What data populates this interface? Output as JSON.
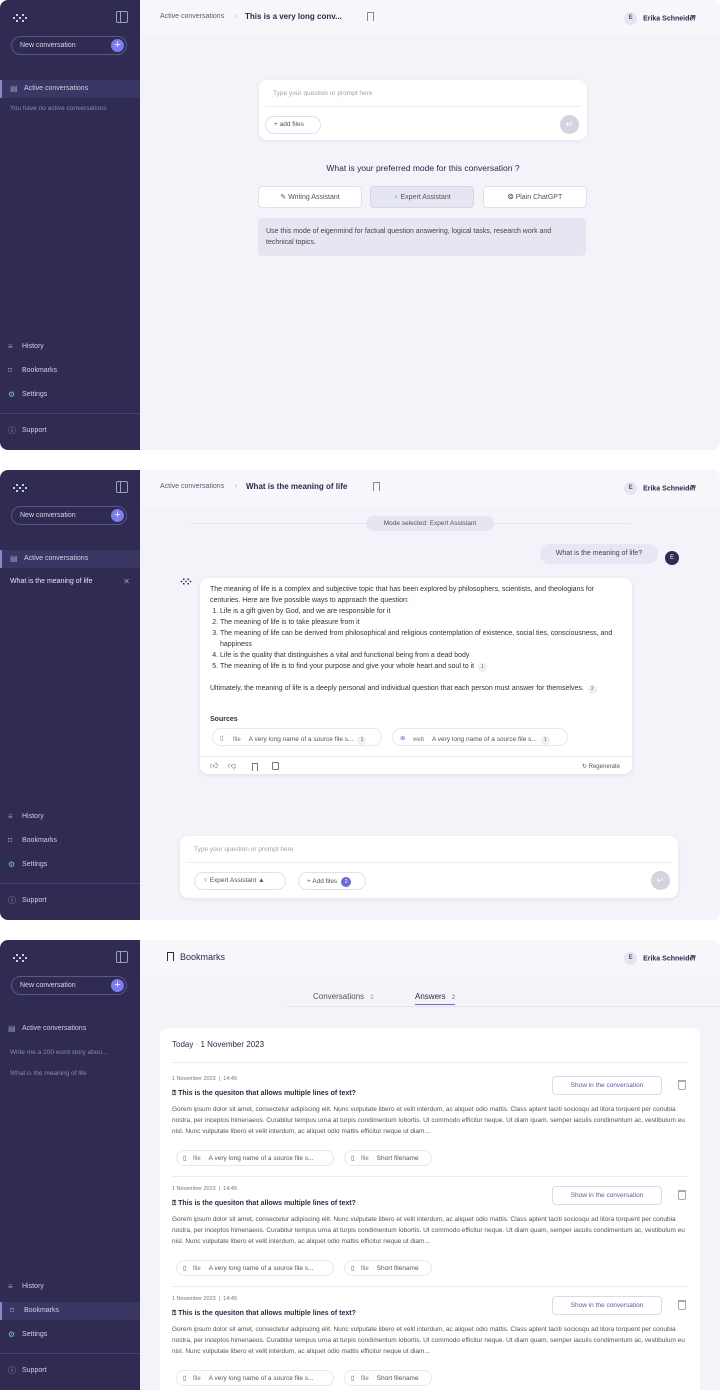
{
  "sidebar": {
    "new_conversation": "New conversation",
    "active_conversations": "Active conversations",
    "no_active": "You have no active conversations",
    "history": "History",
    "bookmarks": "Bookmarks",
    "settings": "Settings",
    "support": "Support",
    "conv_meaning": "What is the meaning of life",
    "conv_story": "Write me a 200 word story abou...",
    "conv_meaning2": "What is the meaning of life"
  },
  "header": {
    "crumb": "Active conversations",
    "title1": "This is a very long conv...",
    "title2": "What is the meaning of life",
    "user": "Erika Schneider",
    "avatar": "E",
    "bookmarks_title": "Bookmarks"
  },
  "composer": {
    "placeholder": "Type your question or prompt here",
    "add_files": "add files",
    "add_files2": "Add files",
    "file_count": "2",
    "mode": "Expert Assistant"
  },
  "mode_select": {
    "question": "What is your preferred mode for this conversation ?",
    "writing": "Writing Assistant",
    "expert": "Expert Assistant",
    "plain": "Plain ChatGPT",
    "description": "Use this mode of eigenmind for factual question answering, logical tasks, research work and technical topics."
  },
  "chat": {
    "mode_banner": "Mode selected: Expert Assistant",
    "user_msg": "What is the meaning of life?",
    "intro": "The meaning of life is a complex and subjective topic that has been explored by philosophers, scientists, and theologians for centuries. Here are five possible ways to approach the question:",
    "points": [
      "Life is a gift given by God, and we are responsible for it",
      "The meaning of life is to take pleasure from it",
      "The meaning of life can be derived from philosophical and religious contemplation of existence, social ties, consciousness, and happiness",
      "Life is the quality that distinguishes a vital and functional being from a dead body",
      "The meaning of life is to find your purpose and give your whole heart and soul to it"
    ],
    "cite1": "1",
    "outro": "Ultimately, the meaning of life is a deeply personal and individual question that each person must answer for themselves.",
    "cite2": "2",
    "sources_label": "Sources",
    "src1_tag": "file",
    "src1_name": "A very long name of a source file s...",
    "src1_num": "1",
    "src2_tag": "web",
    "src2_name": "A very long name of a source file s...",
    "src2_num": "1",
    "regenerate": "Regenerate"
  },
  "bookmarks": {
    "tab_conv": "Conversations",
    "tab_conv_count": "2",
    "tab_ans": "Answers",
    "tab_ans_count": "2",
    "day": "Today",
    "date": "1 November 2023",
    "entries": [
      {
        "date": "1 November 2023",
        "time": "14:45",
        "q": "This is the quesiton that allows multiple lines of text?"
      },
      {
        "date": "1 November 2023",
        "time": "14:45",
        "q": "This is the quesiton that allows multiple lines of text?"
      },
      {
        "date": "1 November 2023",
        "time": "14:45",
        "q": "This is the quesiton that allows multiple lines of text?"
      }
    ],
    "body": "Gorem ipsum dolor sit amet, consectetur adipiscing elit. Nunc vulputate libero et velit interdum, ac aliquet odio mattis. Class aptent taciti sociosqu ad litora torquent per conubia nostra, per inceptos himenaeos. Curabitur tempus urna at turpis condimentum lobortis. Ut commodo efficitur neque. Ut diam quam, semper iaculis condimentum ac, vestibulum eu nisl. Nunc vulputate libero et velit interdum, ac aliquet odio mattis efficitur neque ut diam...",
    "show_btn": "Show in the conversation",
    "file_tag": "file",
    "file1": "A very long name of a source file s...",
    "file2": "Short filename"
  }
}
